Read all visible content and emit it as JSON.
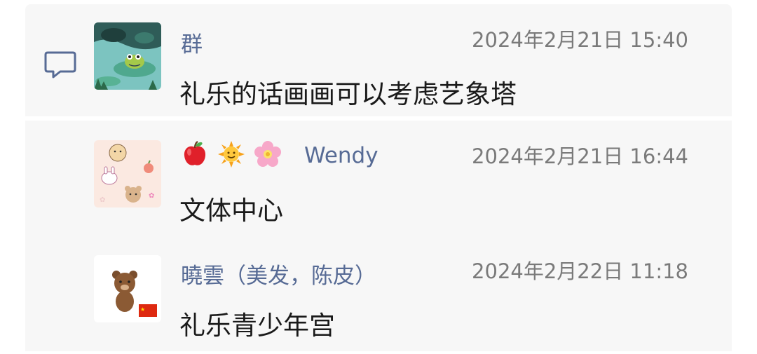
{
  "comments": [
    {
      "name": "群",
      "time": "2024年2月21日 15:40",
      "message": "礼乐的话画画可以考虑艺象塔",
      "avatar": "frog-lilypad-avatar"
    },
    {
      "name_emojis": [
        "apple-emoji",
        "sun-emoji",
        "flower-emoji"
      ],
      "name": "Wendy",
      "time": "2024年2月21日 16:44",
      "message": "文体中心",
      "avatar": "cute-stickers-avatar"
    },
    {
      "name": "曉雲（美发，陈皮）",
      "time": "2024年2月22日 11:18",
      "message": "礼乐青少年宫",
      "avatar": "bear-avatar"
    }
  ],
  "colors": {
    "name": "#576b95",
    "time": "#7a7a7a",
    "message": "#1a1a1a",
    "background": "#f7f7f7"
  },
  "icons": {
    "comment": "comment-bubble-icon"
  }
}
